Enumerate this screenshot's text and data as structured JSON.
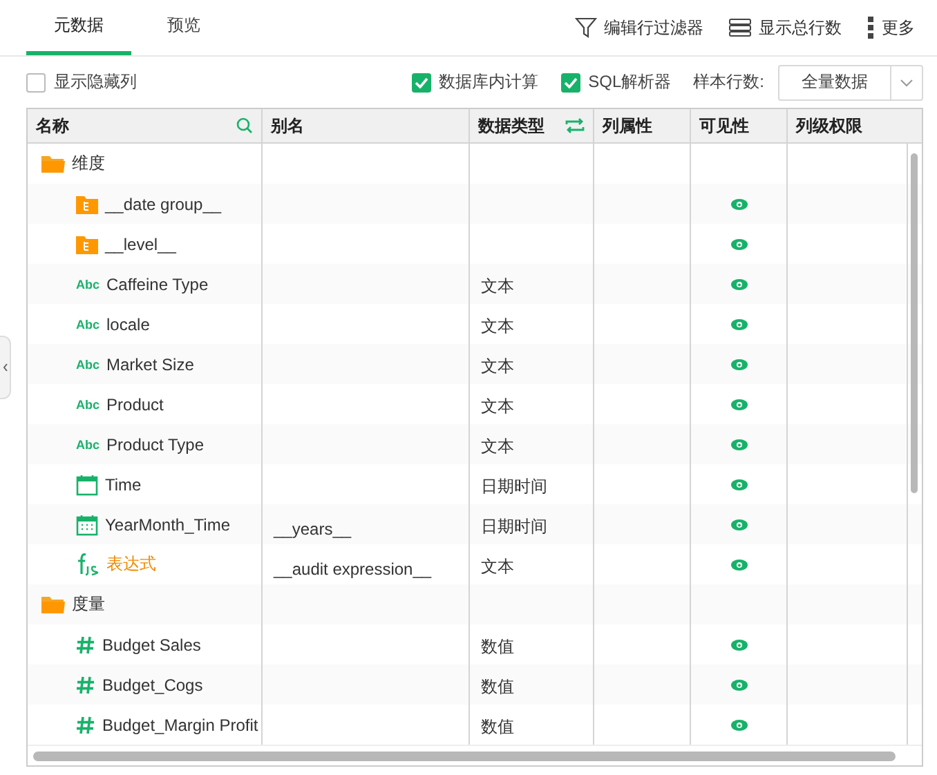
{
  "tabs": [
    {
      "label": "元数据",
      "selected": true
    },
    {
      "label": "预览",
      "selected": false
    }
  ],
  "toolbar": [
    {
      "kind": "filter",
      "label": "编辑行过滤器"
    },
    {
      "kind": "rows",
      "label": "显示总行数"
    },
    {
      "kind": "more",
      "label": "更多"
    }
  ],
  "options": {
    "show_hidden": {
      "label": "显示隐藏列",
      "checked": false
    },
    "in_db": {
      "label": "数据库内计算",
      "checked": true
    },
    "sql": {
      "label": "SQL解析器",
      "checked": true
    },
    "sample_label": "样本行数:",
    "sample_value": "全量数据"
  },
  "table": {
    "columns": [
      "名称",
      "别名",
      "数据类型",
      "列属性",
      "可见性",
      "列级权限"
    ],
    "rows": [
      {
        "kind": "folder",
        "name": "维度"
      },
      {
        "kind": "hierarchy",
        "name": "__date group__",
        "visible": true
      },
      {
        "kind": "hierarchy",
        "name": "__level__",
        "visible": true
      },
      {
        "kind": "text",
        "badge": "Abc",
        "name": "Caffeine Type",
        "type": "文本",
        "visible": true
      },
      {
        "kind": "text",
        "badge": "Abc",
        "name": "locale",
        "type": "文本",
        "visible": true
      },
      {
        "kind": "text",
        "badge": "Abc",
        "name": "Market Size",
        "type": "文本",
        "visible": true
      },
      {
        "kind": "text",
        "badge": "Abc",
        "name": "Product",
        "type": "文本",
        "visible": true
      },
      {
        "kind": "text",
        "badge": "Abc",
        "name": "Product Type",
        "type": "文本",
        "visible": true
      },
      {
        "kind": "date",
        "name": "Time",
        "type": "日期时间",
        "visible": true
      },
      {
        "kind": "datetime",
        "name": "YearMonth_Time",
        "alias": "__years__",
        "type": "日期时间",
        "visible": true
      },
      {
        "kind": "expression",
        "name": "表达式",
        "alias": "__audit expression__",
        "type": "文本",
        "visible": true
      },
      {
        "kind": "folder",
        "name": "度量"
      },
      {
        "kind": "measure",
        "name": "Budget Sales",
        "type": "数值",
        "visible": true
      },
      {
        "kind": "measure",
        "name": "Budget_Cogs",
        "type": "数值",
        "visible": true
      },
      {
        "kind": "measure",
        "name": "Budget_Margin Profit",
        "type": "数值",
        "visible": true
      }
    ]
  }
}
